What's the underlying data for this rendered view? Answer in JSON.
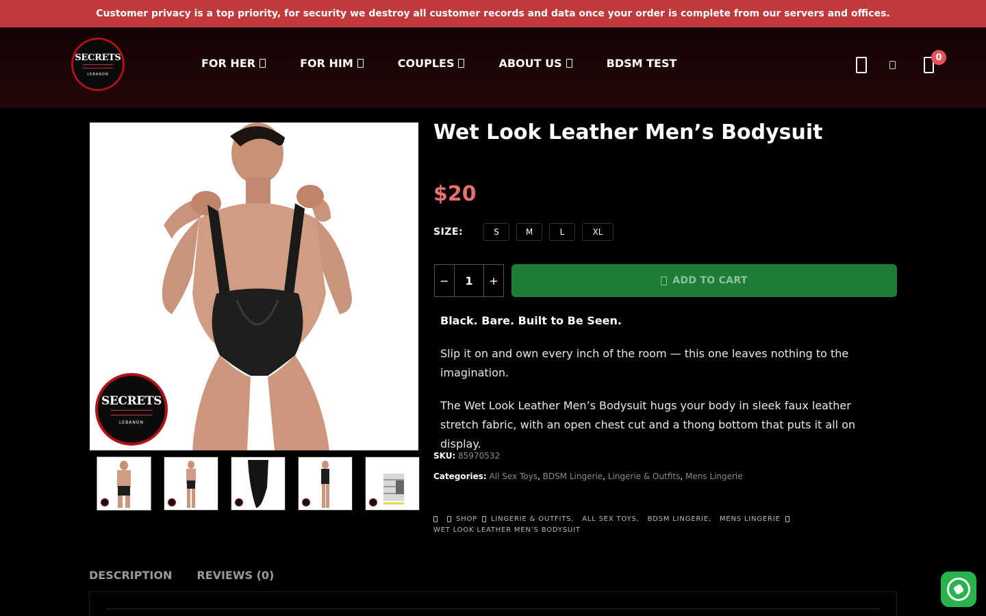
{
  "announcement": "Customer privacy is a top priority, for security we destroy all customer records and data once your order is complete from our servers and offices.",
  "header": {
    "logo_text": "SECRETS",
    "logo_sub": "LEBANON",
    "nav": [
      {
        "label": "FOR HER"
      },
      {
        "label": "FOR HIM"
      },
      {
        "label": "COUPLES"
      },
      {
        "label": "ABOUT US"
      },
      {
        "label": "BDSM TEST"
      }
    ],
    "icons": [
      "user-icon",
      "small-icon",
      "cart-icon"
    ],
    "cart_count": "0"
  },
  "product": {
    "title": "Wet Look Leather Men’s Bodysuit",
    "price": "$20",
    "size_label": "SIZE:",
    "sizes": [
      "S",
      "M",
      "L",
      "XL"
    ],
    "quantity": "1",
    "qty_minus": "−",
    "qty_plus": "+",
    "add_to_cart": "ADD TO CART",
    "desc_heading": "Black. Bare. Built to Be Seen.",
    "desc_p1": "Slip it on and own every inch of the room — this one leaves nothing to the imagination.",
    "desc_p2": "The Wet Look Leather Men’s Bodysuit hugs your body in sleek faux leather stretch fabric, with an open chest cut and a thong bottom that puts it all on display.",
    "sku_label": "SKU:",
    "sku": "85970532",
    "categories_label": "Categories:",
    "categories": [
      "All Sex Toys",
      "BDSM Lingerie",
      "Lingerie & Outfits",
      "Mens Lingerie"
    ],
    "watermark_text": "SECRETS",
    "watermark_sub": "LEBANON"
  },
  "breadcrumb": {
    "shop": "SHOP",
    "cats": [
      "LINGERIE & OUTFITS",
      "ALL SEX TOYS",
      "BDSM LINGERIE",
      "MENS LINGERIE"
    ],
    "current": "WET LOOK LEATHER MEN’S BODYSUIT"
  },
  "tabs": [
    {
      "label": "DESCRIPTION"
    },
    {
      "label": "REVIEWS (0)"
    }
  ],
  "colors": {
    "announcement_bg": "#c0393b",
    "price": "#e8706f",
    "add_to_cart_bg": "#1d7d36",
    "badge": "#e8535a",
    "whatsapp": "#28b34d"
  }
}
